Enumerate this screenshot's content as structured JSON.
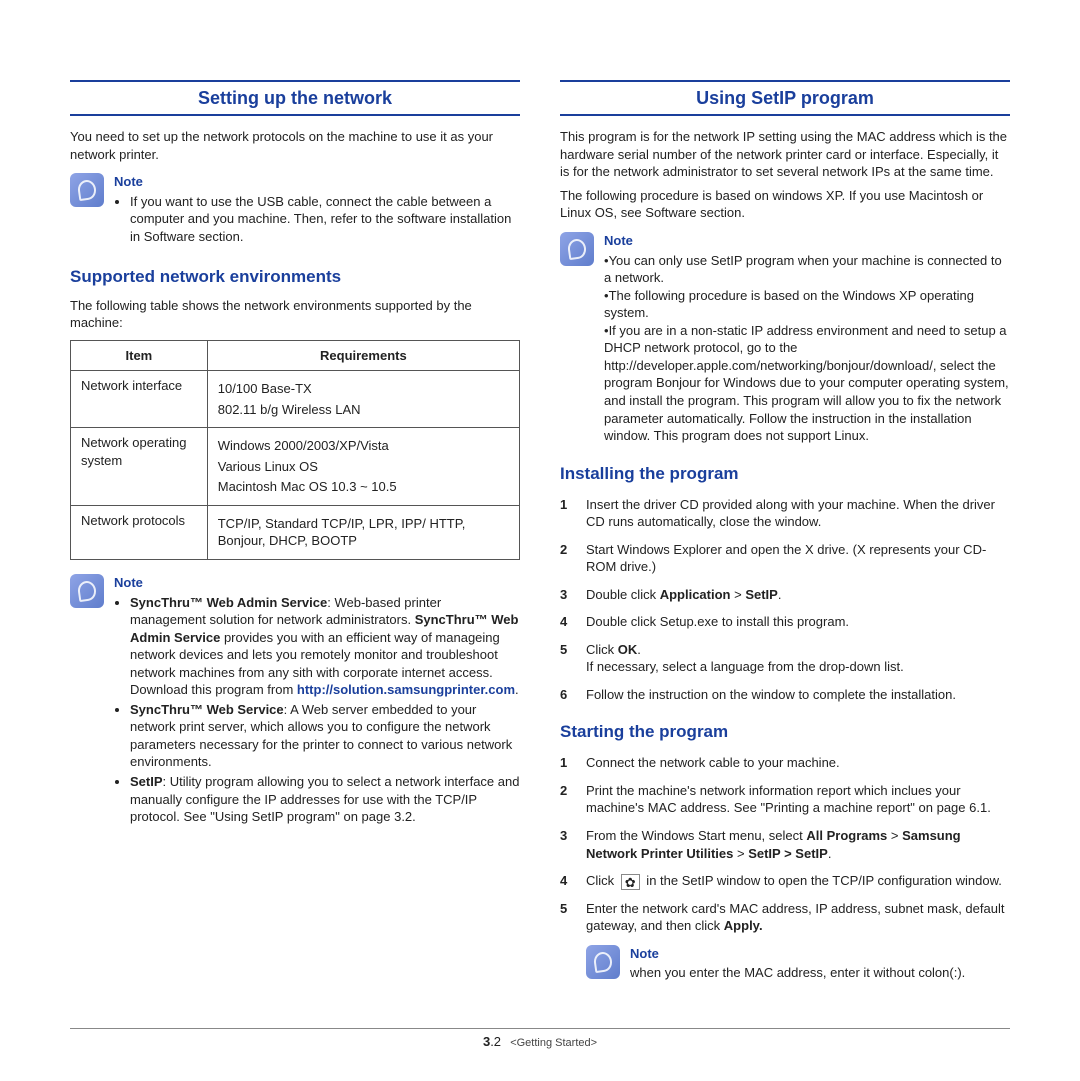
{
  "left": {
    "title": "Setting up the network",
    "intro": "You need to set up the network protocols on the machine to use it as your network printer.",
    "note1_label": "Note",
    "note1_item": "If you want to use the USB cable, connect the cable between a computer and you machine. Then, refer to the software installation in Software section.",
    "subhead": "Supported network environments",
    "table_intro": "The following table shows the network environments supported by the machine:",
    "th_item": "Item",
    "th_req": "Requirements",
    "row1_item": "Network interface",
    "row1_l1": "10/100 Base-TX",
    "row1_l2": "802.11 b/g Wireless LAN",
    "row2_item": "Network operating system",
    "row2_l1": "Windows 2000/2003/XP/Vista",
    "row2_l2": "Various Linux OS",
    "row2_l3": "Macintosh Mac OS 10.3 ~ 10.5",
    "row3_item": "Network protocols",
    "row3_l1": "TCP/IP, Standard TCP/IP, LPR, IPP/ HTTP, Bonjour, DHCP, BOOTP",
    "note2_label": "Note",
    "n2_b1a": "SyncThru™ Web Admin Service",
    "n2_b1b": ": Web-based printer management solution for network administrators. ",
    "n2_b1c": "SyncThru™ Web Admin Service",
    "n2_b1d": " provides you with an efficient way of manageing network devices and lets you remotely monitor and troubleshoot network machines from any sith with corporate internet access. Download this program from ",
    "n2_b1link": "http://solution.samsungprinter.com",
    "n2_b1e": ".",
    "n2_b2a": "SyncThru™ Web Service",
    "n2_b2b": ": A Web server embedded to your network print server, which allows you to configure the network parameters necessary for the printer to connect to various network environments.",
    "n2_b3a": "SetIP",
    "n2_b3b": ": Utility program allowing you to select a network interface and manually configure the IP addresses for use with the TCP/IP protocol. See \"Using SetIP program\" on page 3.2."
  },
  "right": {
    "title": "Using SetIP program",
    "intro1": "This program is for the network IP setting using the MAC address which is the hardware serial number of the network printer card or interface. Especially, it is for the network administrator to set several network IPs at the same time.",
    "intro2": "The following procedure is based on windows XP. If you use Macintosh or Linux OS, see Software section.",
    "note1_label": "Note",
    "note1_i1": "You can only use SetIP program when your machine is connected to a network.",
    "note1_i2": "The following procedure is based on the Windows XP operating system.",
    "note1_i3": "If you are in a non-static IP address environment and need to setup a DHCP network protocol, go to the http://developer.apple.com/networking/bonjour/download/, select the program Bonjour for Windows due to your computer operating system, and install the program. This program will allow you to fix the network parameter automatically. Follow the instruction in the installation window. This program does not support Linux.",
    "install_head": "Installing the program",
    "i1": "Insert the driver CD provided along with your machine. When the driver CD runs automatically, close the window.",
    "i2": "Start Windows Explorer and open the X drive. (X represents your CD-ROM drive.)",
    "i3a": "Double click ",
    "i3b": "Application",
    "i3c": " > ",
    "i3d": "SetIP",
    "i3e": ".",
    "i4": "Double click Setup.exe to install this program.",
    "i5a": "Click ",
    "i5b": "OK",
    "i5c": ".",
    "i5d": "If necessary, select a language from the drop-down list.",
    "i6": "Follow the instruction on the window to complete the installation.",
    "start_head": "Starting the program",
    "s1": "Connect the network cable to your machine.",
    "s2": "Print the machine's network information report which inclues your machine's MAC address. See \"Printing a machine report\" on page 6.1.",
    "s3a": "From the Windows Start menu, select ",
    "s3b": "All Programs",
    "s3c": " > ",
    "s3d": "Samsung Network Printer Utilities",
    "s3e": " > ",
    "s3f": "SetIP > SetIP",
    "s3g": ".",
    "s4a": "Click ",
    "s4b": " in the SetIP window to open the TCP/IP configuration window.",
    "s5a": "Enter the network card's MAC address, IP address, subnet mask, default gateway, and then click ",
    "s5b": "Apply.",
    "note2_label": "Note",
    "note2_text": "when you enter the MAC address, enter it without colon(:)."
  },
  "footer": {
    "page_major": "3",
    "page_minor": ".2",
    "chapter": "<Getting Started>"
  }
}
